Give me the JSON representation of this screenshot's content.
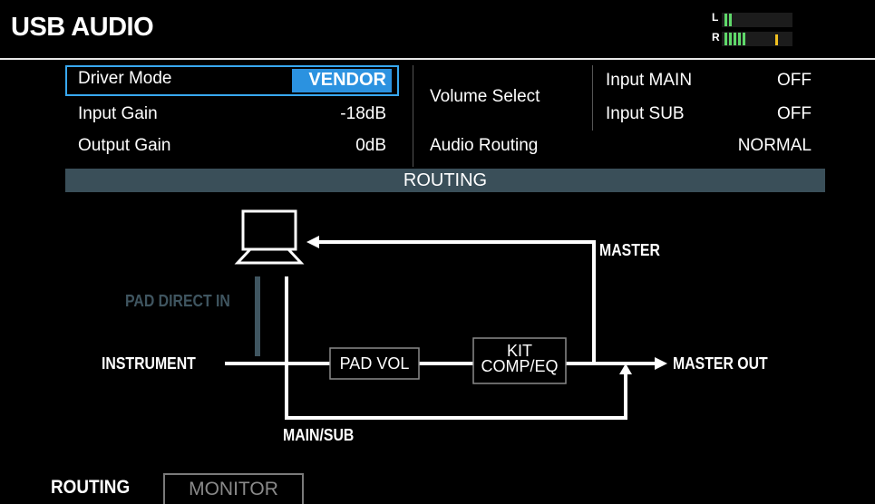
{
  "header": {
    "title": "USB AUDIO",
    "meter": {
      "left_label": "L",
      "right_label": "R"
    }
  },
  "params": {
    "driver_mode": {
      "label": "Driver Mode",
      "value": "VENDOR"
    },
    "input_gain": {
      "label": "Input Gain",
      "value": "-18dB"
    },
    "output_gain": {
      "label": "Output Gain",
      "value": "0dB"
    },
    "volume_select": {
      "label": "Volume Select"
    },
    "input_main": {
      "label": "Input MAIN",
      "value": "OFF"
    },
    "input_sub": {
      "label": "Input SUB",
      "value": "OFF"
    },
    "audio_routing": {
      "label": "Audio Routing",
      "value": "NORMAL"
    }
  },
  "routing": {
    "heading": "ROUTING",
    "labels": {
      "pad_direct_in": "PAD DIRECT IN",
      "instrument": "INSTRUMENT",
      "pad_vol": "PAD VOL",
      "kit_line1": "KIT",
      "kit_line2": "COMP/EQ",
      "master": "MASTER",
      "master_out": "MASTER OUT",
      "main_sub": "MAIN/SUB"
    }
  },
  "tabs": {
    "routing": "ROUTING",
    "monitor": "MONITOR"
  },
  "colors": {
    "accent": "#2b92e0",
    "highlight_border": "#38a8f0",
    "routing_bar": "#3a4f59",
    "meter_green": "#5fd86a",
    "meter_yellow": "#f0c020",
    "dim_line": "#3f5560"
  }
}
